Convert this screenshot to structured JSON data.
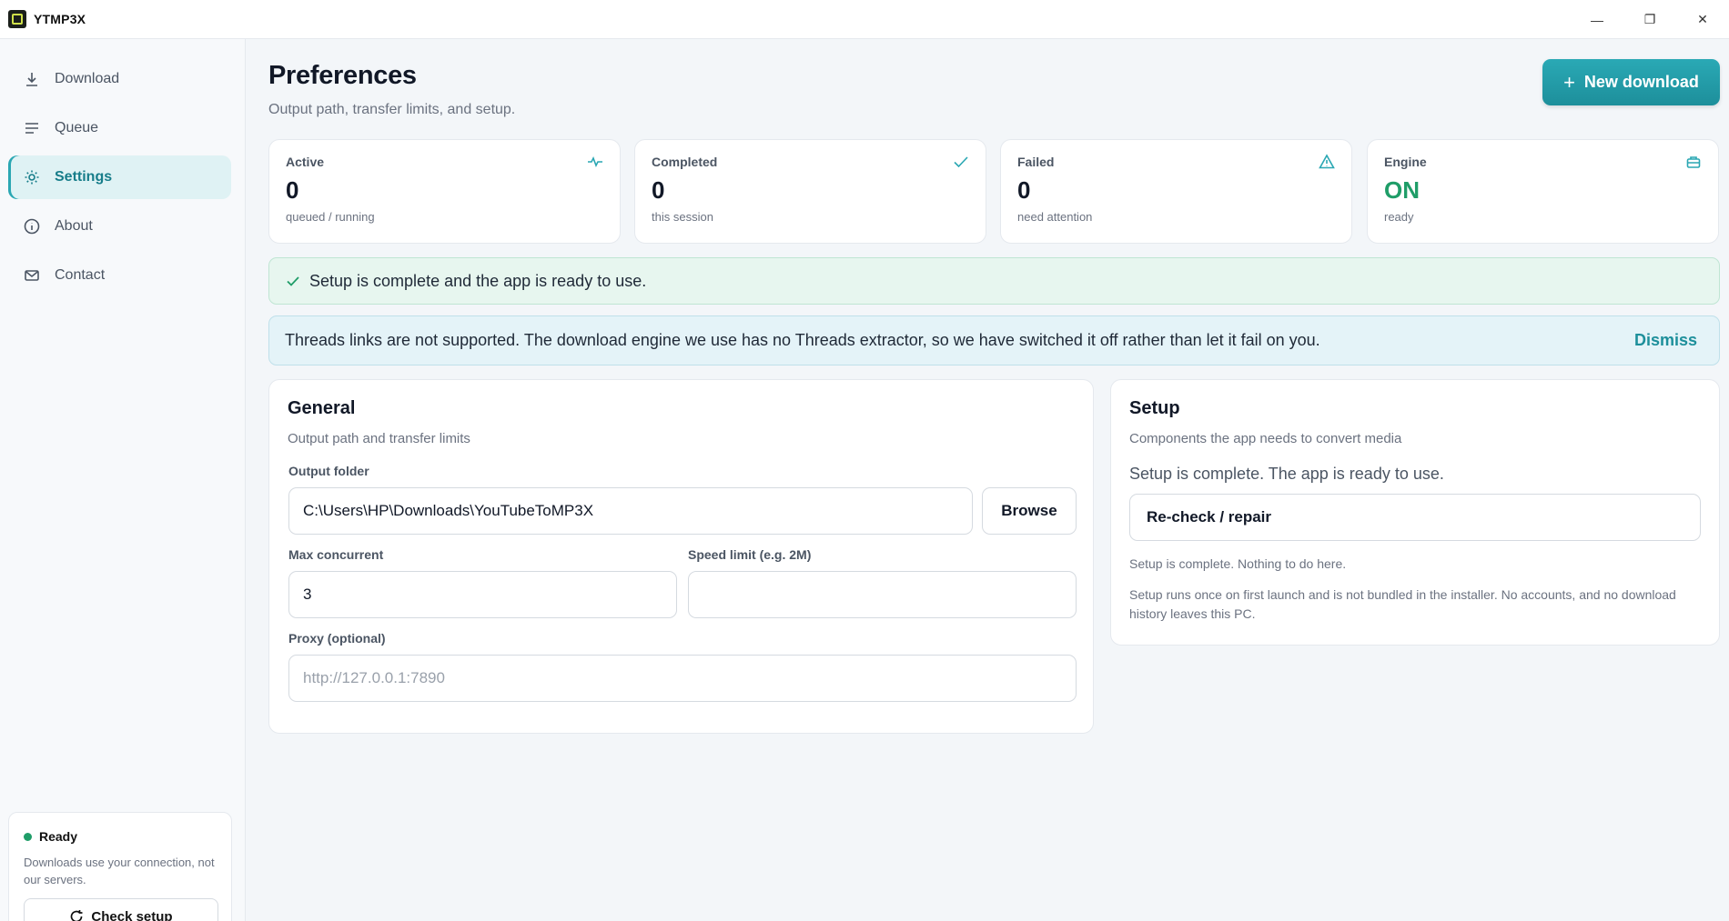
{
  "window": {
    "title": "YTMP3X",
    "controls": {
      "minimize": "—",
      "maximize": "❐",
      "close": "✕"
    }
  },
  "sidebar": {
    "items": [
      {
        "label": "Download",
        "icon": "download-icon"
      },
      {
        "label": "Queue",
        "icon": "list-icon"
      },
      {
        "label": "Settings",
        "icon": "gear-icon",
        "active": true
      },
      {
        "label": "About",
        "icon": "info-icon"
      },
      {
        "label": "Contact",
        "icon": "mail-icon"
      }
    ],
    "status": {
      "label": "Ready",
      "description": "Downloads use your connection, not our servers.",
      "button": "Check setup"
    }
  },
  "header": {
    "title": "Preferences",
    "subtitle": "Output path, transfer limits, and setup.",
    "new_button": "New download"
  },
  "stats": [
    {
      "label": "Active",
      "value": "0",
      "foot": "queued / running",
      "icon": "activity-icon"
    },
    {
      "label": "Completed",
      "value": "0",
      "foot": "this session",
      "icon": "check-icon"
    },
    {
      "label": "Failed",
      "value": "0",
      "foot": "need attention",
      "icon": "warning-icon"
    },
    {
      "label": "Engine",
      "value": "ON",
      "foot": "ready",
      "icon": "engine-icon"
    }
  ],
  "banners": {
    "success": "Setup is complete and the app is ready to use.",
    "info": "Threads links are not supported. The download engine we use has no Threads extractor, so we have switched it off rather than let it fail on you.",
    "dismiss": "Dismiss"
  },
  "general": {
    "title": "General",
    "subtitle": "Output path and transfer limits",
    "output_label": "Output folder",
    "output_value": "C:\\Users\\HP\\Downloads\\YouTubeToMP3X",
    "browse": "Browse",
    "max_label": "Max concurrent",
    "max_value": "3",
    "speed_label": "Speed limit (e.g. 2M)",
    "speed_value": "",
    "proxy_label": "Proxy (optional)",
    "proxy_placeholder": "http://127.0.0.1:7890"
  },
  "setup": {
    "title": "Setup",
    "subtitle": "Components the app needs to convert media",
    "status": "Setup is complete. The app is ready to use.",
    "recheck": "Re-check / repair",
    "note1": "Setup is complete. Nothing to do here.",
    "note2": "Setup runs once on first launch and is not bundled in the installer. No accounts, and no download history leaves this PC."
  },
  "colors": {
    "accent": "#2aa7b3",
    "success": "#1f9d68"
  }
}
